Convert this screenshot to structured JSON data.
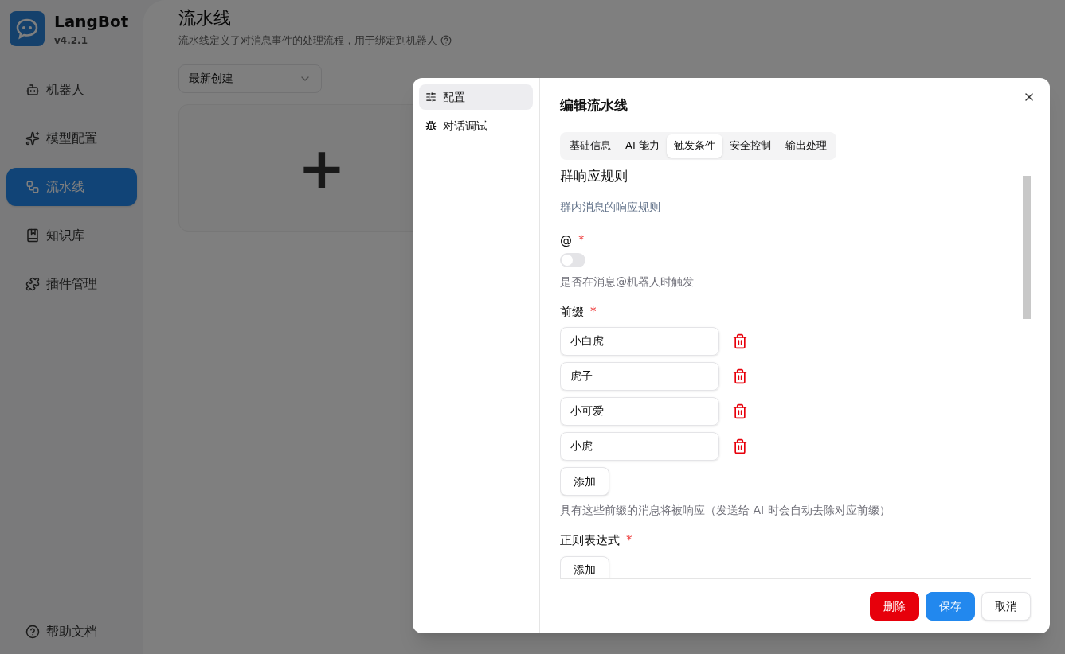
{
  "app": {
    "name": "LangBot",
    "version": "v4.2.1"
  },
  "nav": [
    {
      "label": "机器人",
      "selected": false
    },
    {
      "label": "模型配置",
      "selected": false
    },
    {
      "label": "流水线",
      "selected": true
    },
    {
      "label": "知识库",
      "selected": false
    },
    {
      "label": "插件管理",
      "selected": false
    }
  ],
  "help_link": "帮助文档",
  "page": {
    "title": "流水线",
    "description": "流水线定义了对消息事件的处理流程，用于绑定到机器人",
    "sort_select": "最新创建",
    "add_card": "+"
  },
  "dialog": {
    "side_tabs": [
      {
        "label": "配置",
        "selected": true
      },
      {
        "label": "对话调试",
        "selected": false
      }
    ],
    "title": "编辑流水线",
    "tabs": [
      {
        "label": "基础信息",
        "selected": false
      },
      {
        "label": "AI 能力",
        "selected": false
      },
      {
        "label": "触发条件",
        "selected": true
      },
      {
        "label": "安全控制",
        "selected": false
      },
      {
        "label": "输出处理",
        "selected": false
      }
    ],
    "section_title": "群响应规则",
    "section_description": "群内消息的响应规则",
    "fields": [
      {
        "kind": "switch",
        "label": "@",
        "required_mark": "*",
        "on": false,
        "hint": "是否在消息@机器人时触发"
      },
      {
        "kind": "list",
        "label": "前缀",
        "required_mark": "*",
        "items": [
          "小白虎",
          "虎子",
          "小可爱",
          "小虎"
        ],
        "add_label": "添加",
        "hint": "具有这些前缀的消息将被响应（发送给 AI 时会自动去除对应前缀）"
      },
      {
        "kind": "list",
        "label": "正则表达式",
        "required_mark": "*",
        "add_label": "添加"
      }
    ],
    "buttons": [
      {
        "kind": "danger",
        "label": "删除"
      },
      {
        "kind": "primary",
        "label": "保存"
      },
      {
        "kind": "secondary",
        "label": "取消"
      }
    ]
  }
}
